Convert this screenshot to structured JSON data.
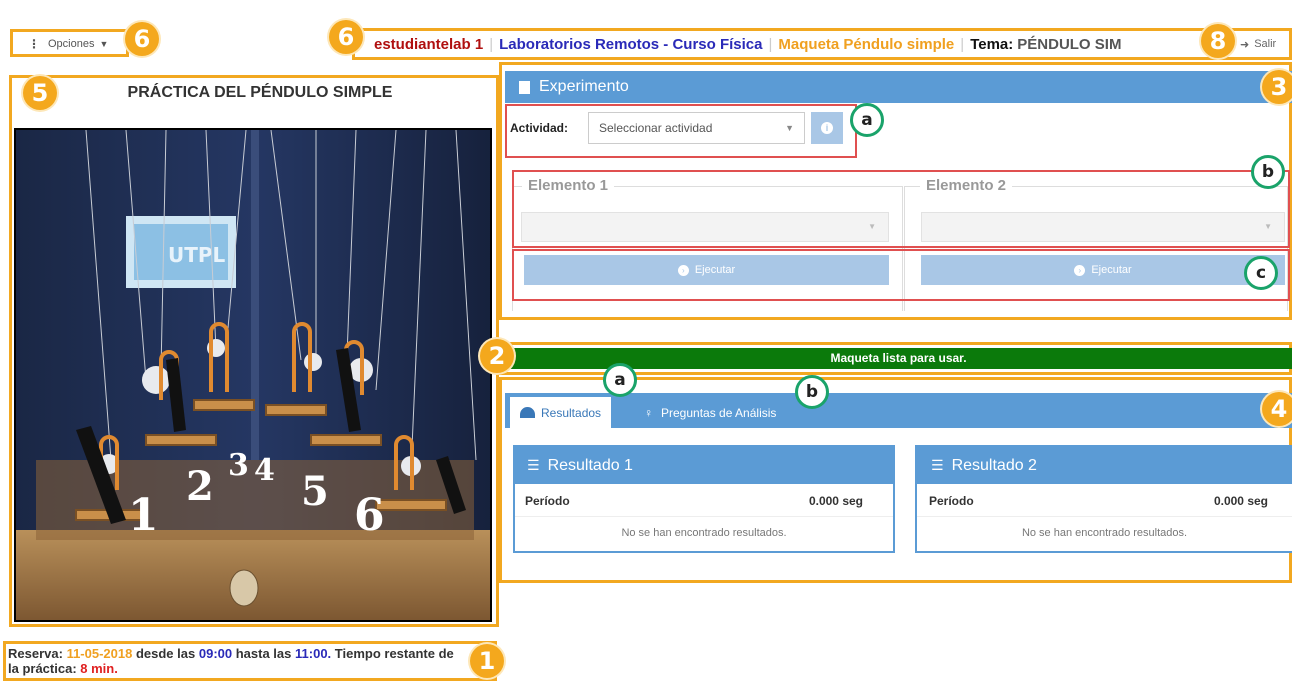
{
  "menu": {
    "options_label": "Opciones"
  },
  "header": {
    "user": "estudiantelab 1",
    "course": "Laboratorios Remotos - Curso Física",
    "model": "Maqueta Péndulo simple",
    "topic_label": "Tema:",
    "topic": "PÉNDULO SIM",
    "exit_label": "Salir"
  },
  "video": {
    "title": "PRÁCTICA DEL PÉNDULO SIMPLE",
    "pendulum_numbers": [
      "1",
      "2",
      "3",
      "4",
      "5",
      "6"
    ],
    "banner_text": "UTPL"
  },
  "reservation": {
    "label": "Reserva:",
    "date": "11-05-2018",
    "from_label": "desde las",
    "start": "09:00",
    "to_label": "hasta las",
    "end": "11:00.",
    "remaining_label": "Tiempo restante de la práctica:",
    "remaining": "8 min."
  },
  "experiment": {
    "title": "Experimento",
    "activity_label": "Actividad:",
    "activity_placeholder": "Seleccionar actividad",
    "elements": [
      {
        "label": "Elemento 1",
        "button": "Ejecutar"
      },
      {
        "label": "Elemento 2",
        "button": "Ejecutar"
      }
    ]
  },
  "status": {
    "message": "Maqueta lista para usar."
  },
  "tabs": [
    {
      "label": "Resultados"
    },
    {
      "label": "Preguntas de Análisis"
    }
  ],
  "results": [
    {
      "title": "Resultado 1",
      "col_label": "Período",
      "value": "0.000 seg",
      "empty": "No se han encontrado resultados."
    },
    {
      "title": "Resultado 2",
      "col_label": "Período",
      "value": "0.000 seg",
      "empty": "No se han encontrado resultados."
    }
  ],
  "annotations": {
    "n1": "1",
    "n2": "2",
    "n3": "3",
    "n4": "4",
    "n5": "5",
    "n6": "6",
    "n8": "8",
    "a": "a",
    "b": "b",
    "c": "c"
  },
  "colors": {
    "annotation_orange": "#f4a81d",
    "highlight_red": "#e05050",
    "panel_blue": "#5b9bd5",
    "status_green": "#0b7a0b",
    "user_red": "#b01010",
    "course_blue": "#2a2ab8",
    "model_orange": "#f0a020"
  }
}
